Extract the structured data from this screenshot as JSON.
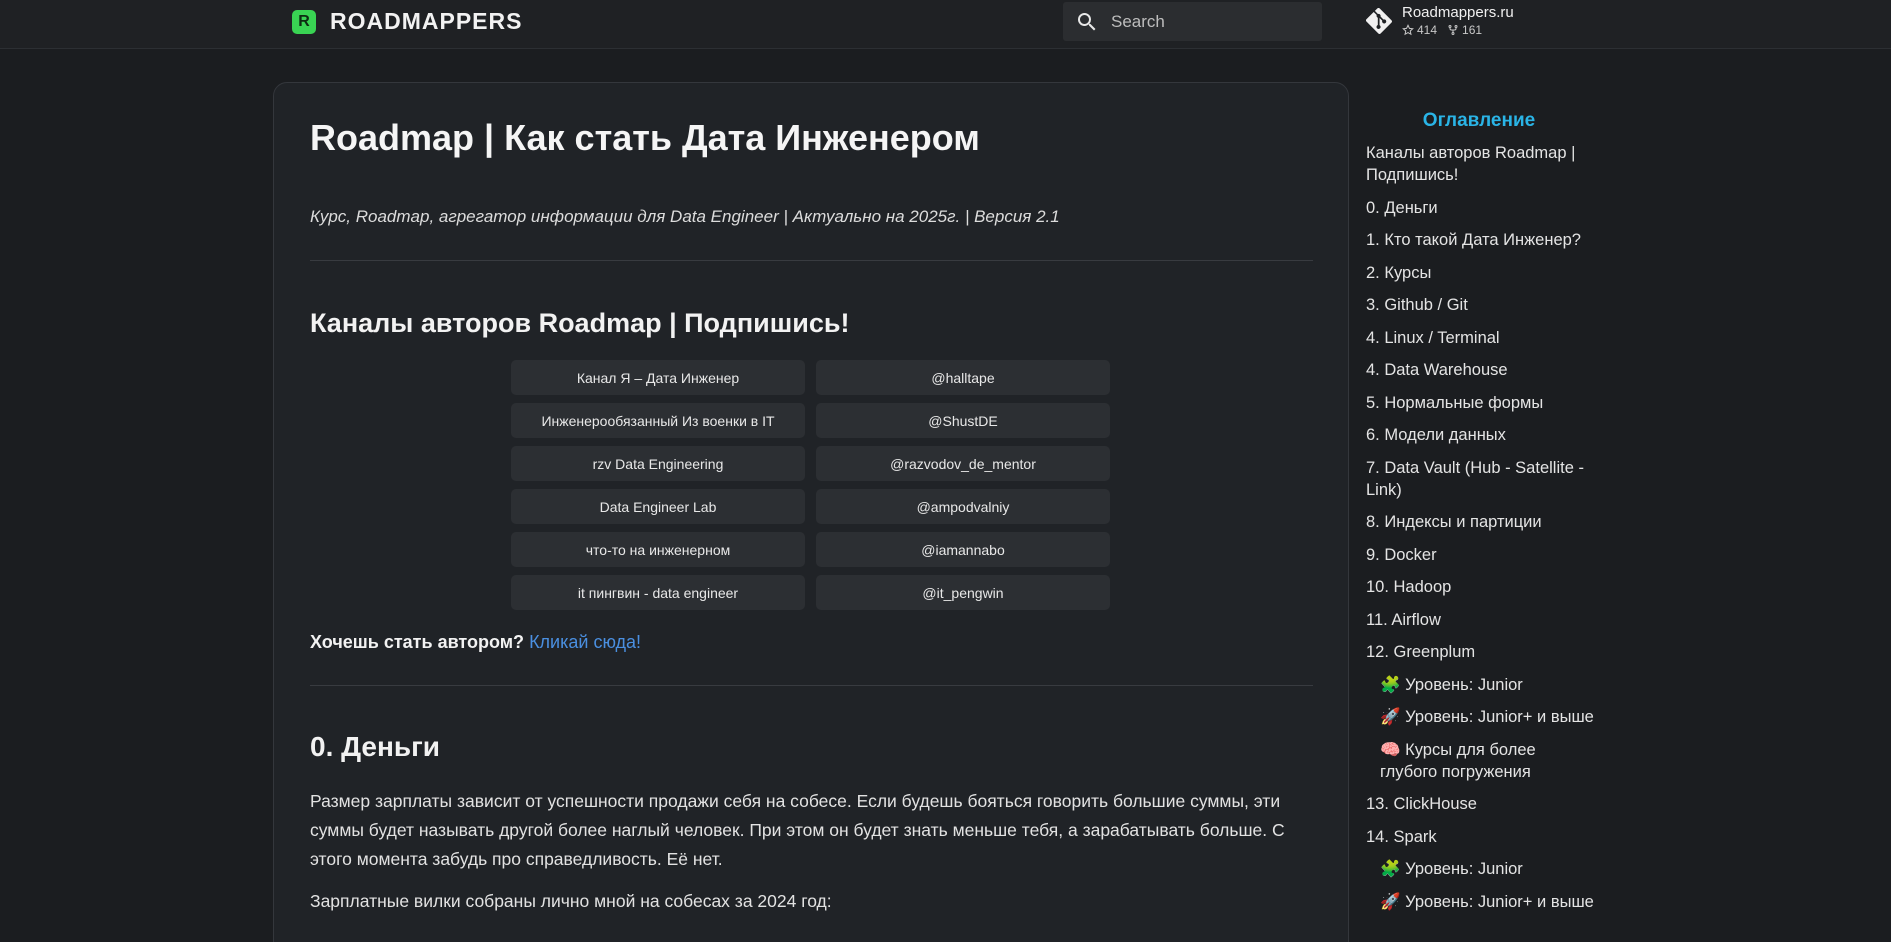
{
  "header": {
    "logo_letter": "R",
    "brand": "ROADMAPPERS",
    "search_placeholder": "Search",
    "repo_name": "Roadmappers.ru",
    "repo_stars": "414",
    "repo_forks": "161"
  },
  "article": {
    "title": "Roadmap | Как стать Дата Инженером",
    "subtitle": "Курс, Roadmap, агрегатор информации для Data Engineer | Актуально на 2025г. | Версия 2.1",
    "channels_heading": "Каналы авторов Roadmap | Подпишись!",
    "channels": [
      {
        "name": "Канал Я – Дата Инженер",
        "handle": "@halltape"
      },
      {
        "name": "Инженерообязанный Из военки в IT",
        "handle": "@ShustDE"
      },
      {
        "name": "rzv Data Engineering",
        "handle": "@razvodov_de_mentor"
      },
      {
        "name": "Data Engineer Lab",
        "handle": "@ampodvalniy"
      },
      {
        "name": "что-то на инженерном",
        "handle": "@iamannabo"
      },
      {
        "name": "it пингвин - data engineer",
        "handle": "@it_pengwin"
      }
    ],
    "author_question": "Хочешь стать автором?",
    "author_link": "Кликай сюда!",
    "money_heading": "0. Деньги",
    "money_paragraph": "Размер зарплаты зависит от успешности продажи себя на собесе. Если будешь бояться говорить большие суммы, эти суммы будет называть другой более наглый человек. При этом он будет знать меньше тебя, а зарабатывать больше. С этого момента забудь про справедливость. Её нет.",
    "salary_intro": "Зарплатные вилки собраны лично мной на собесах за 2024 год:"
  },
  "toc": {
    "title": "Оглавление",
    "items": [
      {
        "label": "Каналы авторов Roadmap | Подпишись!",
        "sub": false
      },
      {
        "label": "0. Деньги",
        "sub": false
      },
      {
        "label": "1. Кто такой Дата Инженер?",
        "sub": false
      },
      {
        "label": "2. Курсы",
        "sub": false
      },
      {
        "label": "3. Github / Git",
        "sub": false
      },
      {
        "label": "4. Linux / Terminal",
        "sub": false
      },
      {
        "label": "4. Data Warehouse",
        "sub": false
      },
      {
        "label": "5. Нормальные формы",
        "sub": false
      },
      {
        "label": "6. Модели данных",
        "sub": false
      },
      {
        "label": "7. Data Vault (Hub - Satellite - Link)",
        "sub": false
      },
      {
        "label": "8. Индексы и партиции",
        "sub": false
      },
      {
        "label": "9. Docker",
        "sub": false
      },
      {
        "label": "10. Hadoop",
        "sub": false
      },
      {
        "label": "11. Airflow",
        "sub": false
      },
      {
        "label": "12. Greenplum",
        "sub": false
      },
      {
        "label": "🧩 Уровень: Junior",
        "sub": true
      },
      {
        "label": "🚀 Уровень: Junior+ и выше",
        "sub": true
      },
      {
        "label": "🧠 Курсы для более глубого погружения",
        "sub": true
      },
      {
        "label": "13. ClickHouse",
        "sub": false
      },
      {
        "label": "14. Spark",
        "sub": false
      },
      {
        "label": "🧩 Уровень: Junior",
        "sub": true
      },
      {
        "label": "🚀 Уровень: Junior+ и выше",
        "sub": true
      }
    ]
  }
}
